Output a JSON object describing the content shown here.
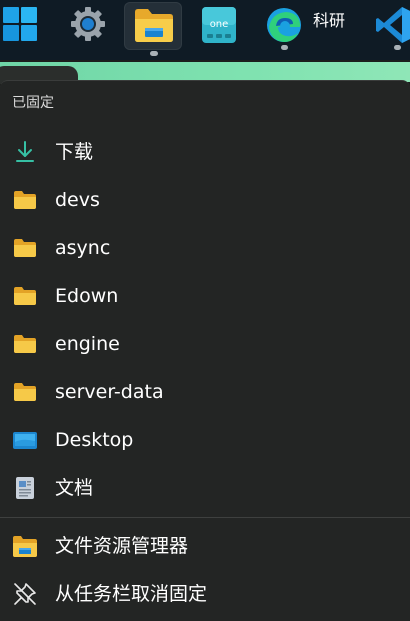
{
  "taskbar": {
    "apps": [
      {
        "icon": "windows-start-icon"
      },
      {
        "icon": "settings-gear-icon"
      },
      {
        "icon": "file-explorer-icon",
        "active": true
      },
      {
        "icon": "onenote-icon",
        "badge": "one"
      },
      {
        "icon": "edge-browser-icon",
        "label": "科研"
      },
      {
        "icon": "vscode-icon"
      }
    ]
  },
  "jumplist": {
    "pinned_title": "已固定",
    "pinned": [
      {
        "label": "下载",
        "icon": "download-icon"
      },
      {
        "label": "devs",
        "icon": "folder-icon"
      },
      {
        "label": "async",
        "icon": "folder-icon"
      },
      {
        "label": "Edown",
        "icon": "folder-icon"
      },
      {
        "label": "engine",
        "icon": "folder-icon"
      },
      {
        "label": "server-data",
        "icon": "folder-icon"
      },
      {
        "label": "Desktop",
        "icon": "desktop-icon"
      },
      {
        "label": "文档",
        "icon": "document-icon"
      }
    ],
    "actions": [
      {
        "label": "文件资源管理器",
        "icon": "file-explorer-icon"
      },
      {
        "label": "从任务栏取消固定",
        "icon": "unpin-icon"
      }
    ]
  },
  "colors": {
    "accent_green": "#2fb39a",
    "folder_yellow": "#f4c542",
    "taskbar_bg": "#0f1b25",
    "menu_bg": "#232524"
  }
}
